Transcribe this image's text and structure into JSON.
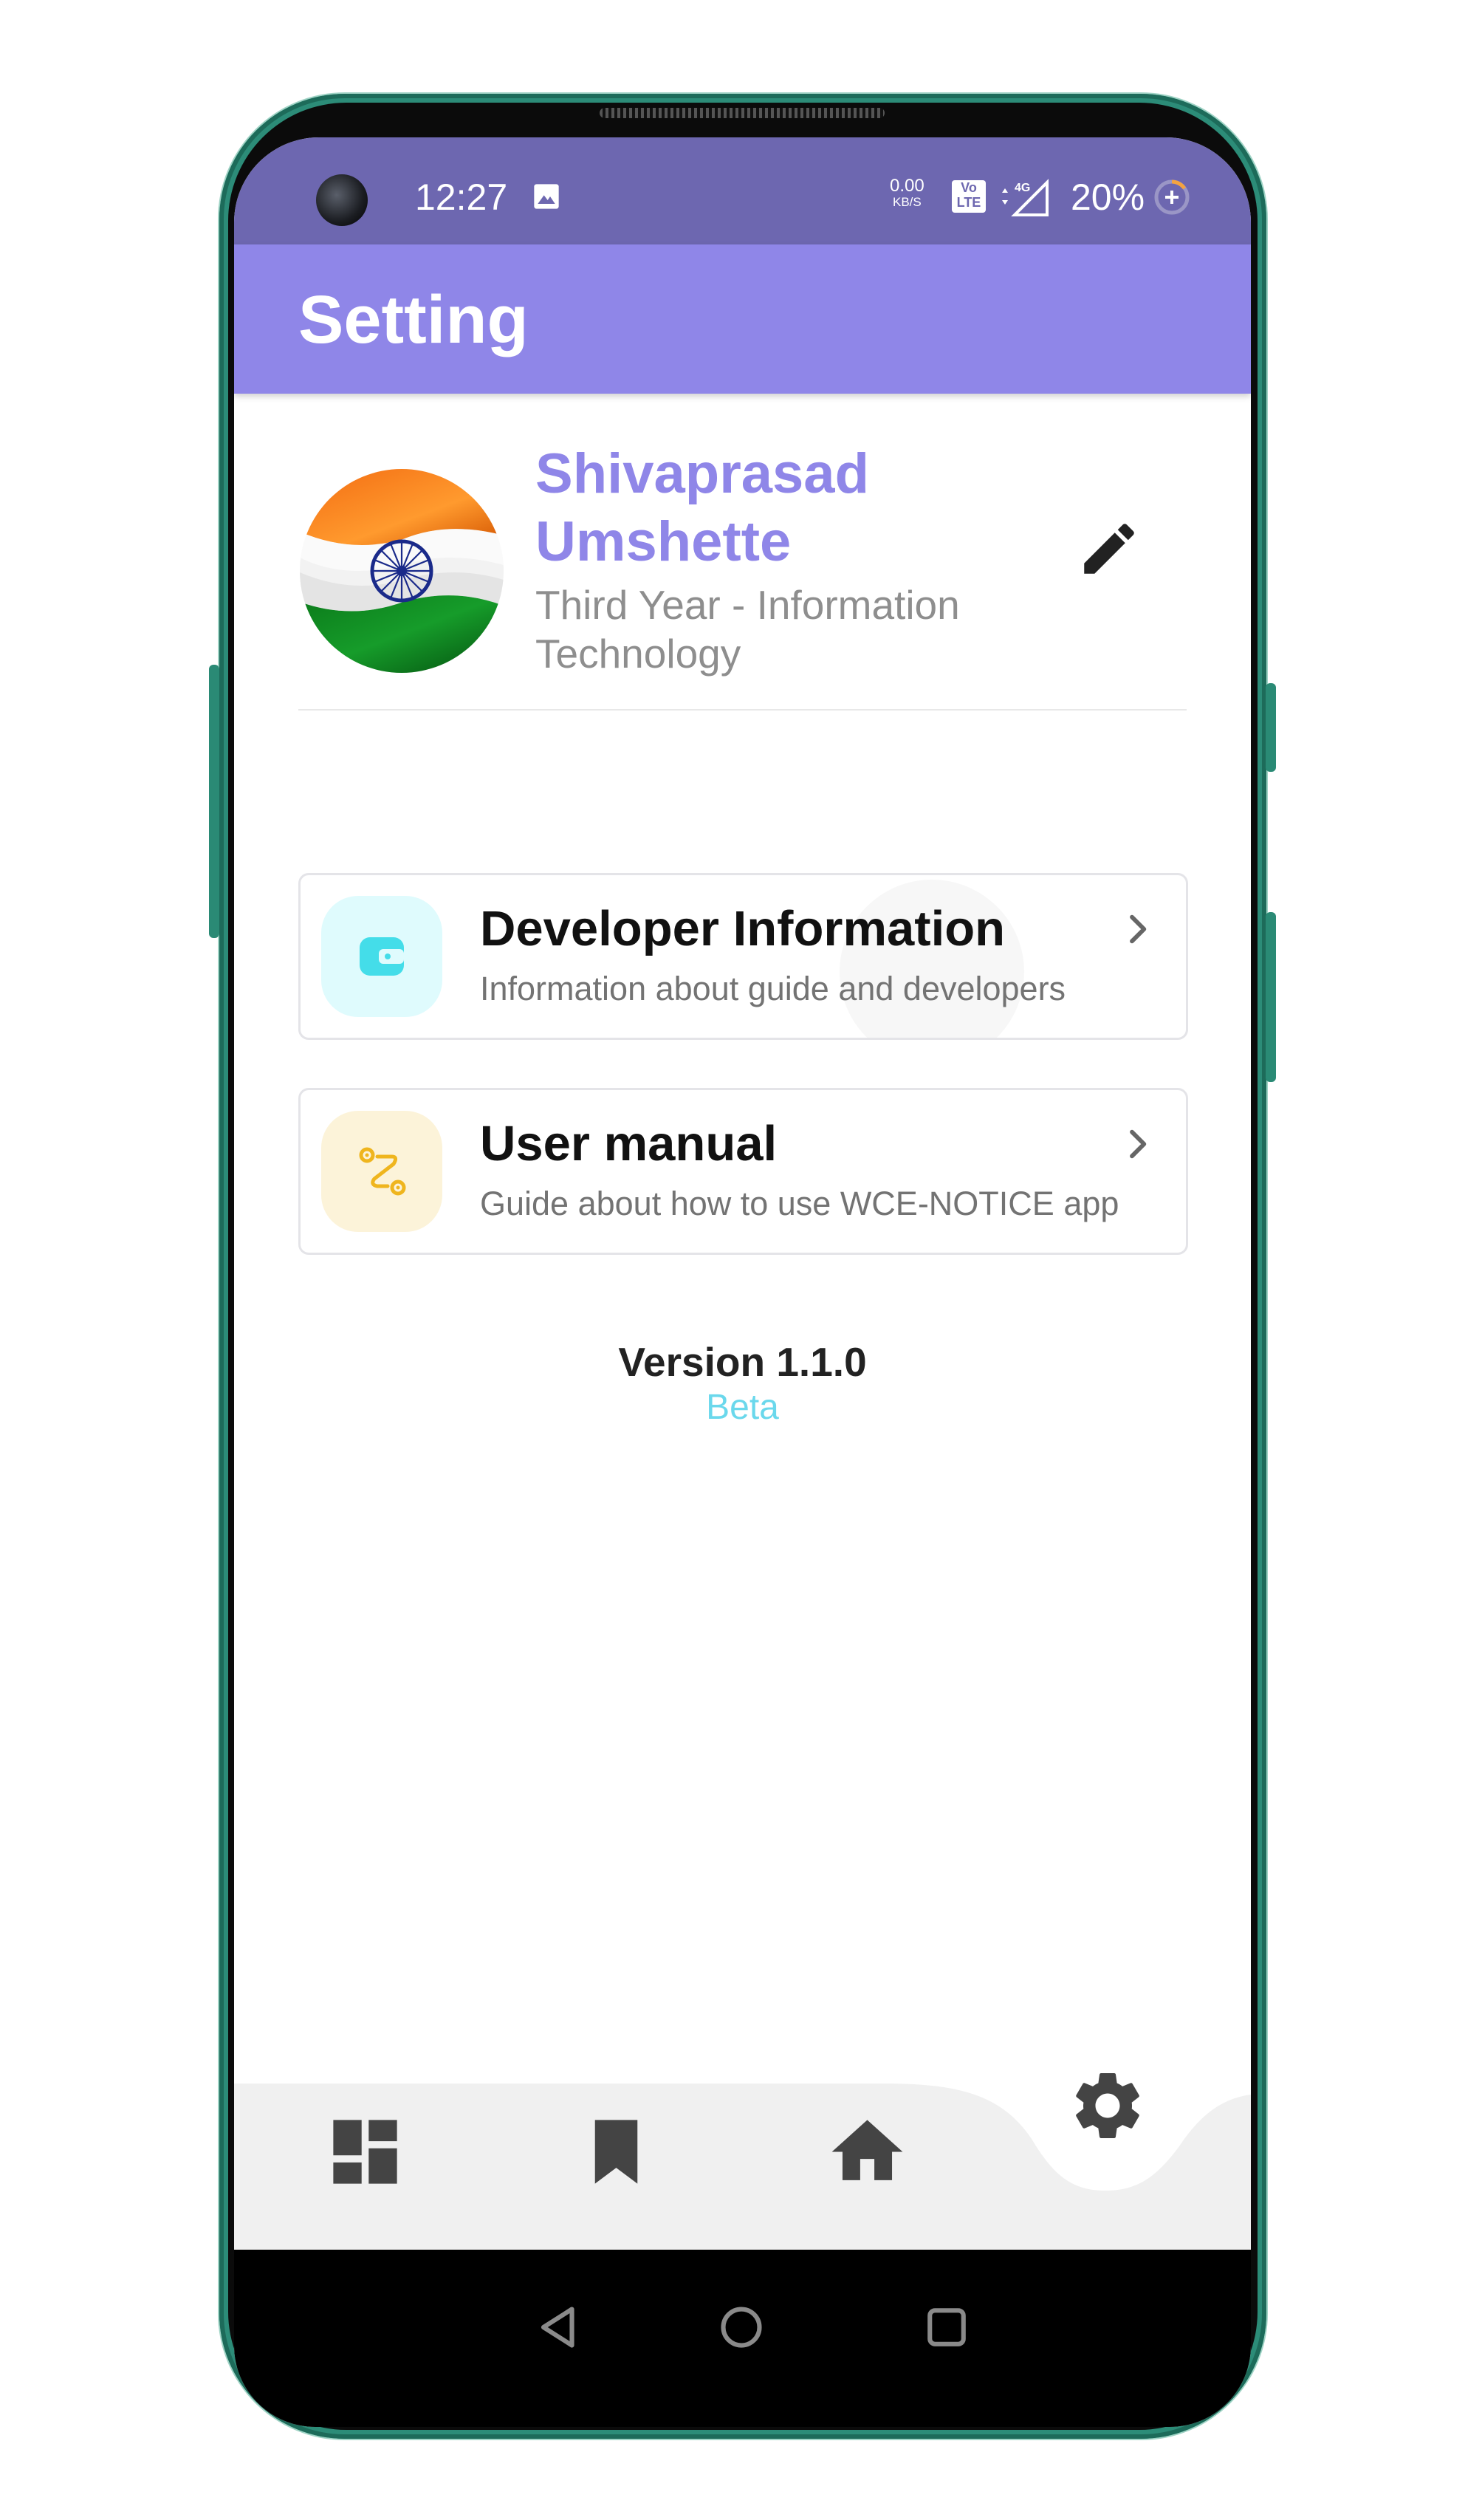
{
  "status_bar": {
    "time": "12:27",
    "net_speed_value": "0.00",
    "net_speed_unit": "KB/S",
    "volte": "Vo LTE",
    "network": "4G",
    "battery": "20%"
  },
  "app_bar": {
    "title": "Setting"
  },
  "profile": {
    "name_line1": "Shivaprasad",
    "name_line2": "Umshette",
    "subtitle_line1": "Third Year - Information",
    "subtitle_line2": "Technology"
  },
  "cards": [
    {
      "title": "Developer Information",
      "subtitle": "Information about guide and developers",
      "icon": "wallet-icon"
    },
    {
      "title": "User manual",
      "subtitle": "Guide about how to use WCE-NOTICE app",
      "icon": "route-icon"
    }
  ],
  "version": {
    "label": "Version 1.1.0",
    "channel": "Beta"
  },
  "bottom_nav": [
    {
      "icon": "dashboard-icon"
    },
    {
      "icon": "bookmark-icon"
    },
    {
      "icon": "home-icon"
    },
    {
      "icon": "settings-icon",
      "active": true
    }
  ],
  "system_nav": [
    "back-icon",
    "home-circle-icon",
    "recents-icon"
  ],
  "colors": {
    "status_bar": "#6d67b0",
    "app_bar": "#8f86e8",
    "accent_name": "#8f86e8",
    "beta": "#6ad8ec",
    "card1_icon_bg": "#dffbfd",
    "card2_icon_bg": "#fcf3d9",
    "nav_bg": "#f0f0f0"
  }
}
